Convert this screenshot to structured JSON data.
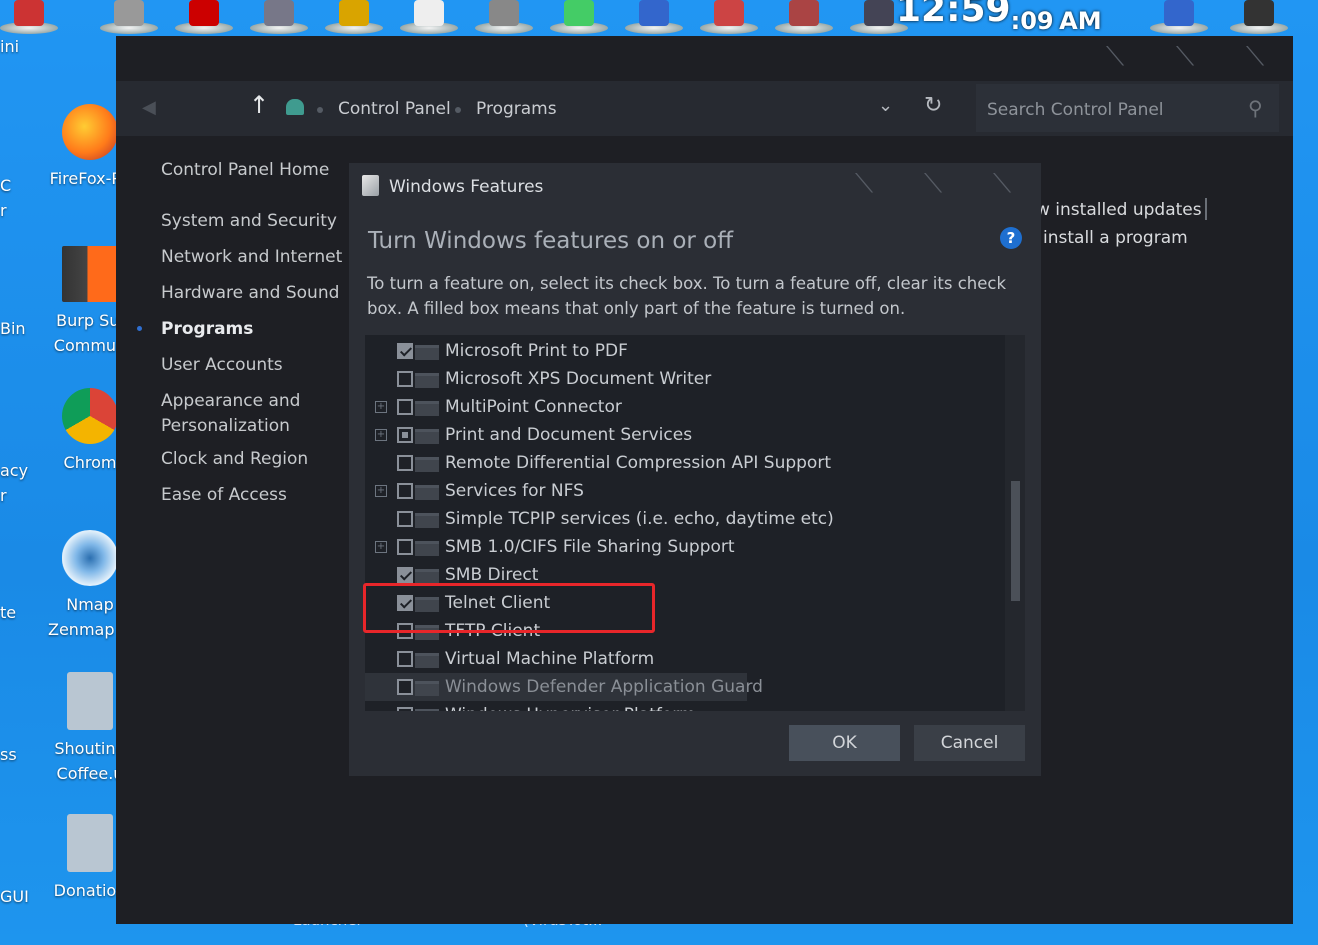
{
  "clock": {
    "time": "12:59",
    "seconds": ":09",
    "ampm": "AM"
  },
  "desktop": {
    "left_labels": [
      "ini",
      "C",
      "r",
      "Bin",
      "acy",
      "r",
      "te",
      "ss",
      "GUI"
    ],
    "icons": [
      {
        "name": "firefox",
        "lines": [
          "FireFox-Pe"
        ]
      },
      {
        "name": "burp",
        "lines": [
          "Burp Sui",
          "Commun"
        ]
      },
      {
        "name": "chrome",
        "lines": [
          "Chrom"
        ]
      },
      {
        "name": "nmap",
        "lines": [
          "Nmap",
          "Zenmap G"
        ]
      },
      {
        "name": "shouting-file",
        "lines": [
          "Shouting",
          "Coffee.u"
        ]
      },
      {
        "name": "donation-file",
        "lines": [
          "Donation"
        ]
      }
    ],
    "bottom_texts": [
      "Launcher",
      "(VirusTot..."
    ]
  },
  "control_panel": {
    "breadcrumb": [
      "Control Panel",
      "Programs"
    ],
    "search_placeholder": "Search Control Panel",
    "sidebar": [
      {
        "label": "Control Panel Home",
        "active": false
      },
      {
        "label": "System and Security",
        "active": false
      },
      {
        "label": "Network and Internet",
        "active": false
      },
      {
        "label": "Hardware and Sound",
        "active": false
      },
      {
        "label": "Programs",
        "active": true
      },
      {
        "label": "User Accounts",
        "active": false
      },
      {
        "label": "Appearance and",
        "active": false
      },
      {
        "label": "Personalization",
        "active": false
      },
      {
        "label": "Clock and Region",
        "active": false
      },
      {
        "label": "Ease of Access",
        "active": false
      }
    ],
    "right_links": [
      "w installed updates",
      "install a program"
    ]
  },
  "dialog": {
    "title": "Windows Features",
    "heading": "Turn Windows features on or off",
    "description": "To turn a feature on, select its check box. To turn a feature off, clear its check box. A filled box means that only part of the feature is turned on.",
    "help": "?",
    "features": [
      {
        "label": "Microsoft Print to PDF",
        "state": "checked",
        "expandable": false
      },
      {
        "label": "Microsoft XPS Document Writer",
        "state": "unchecked",
        "expandable": false
      },
      {
        "label": "MultiPoint Connector",
        "state": "unchecked",
        "expandable": true
      },
      {
        "label": "Print and Document Services",
        "state": "partial",
        "expandable": true
      },
      {
        "label": "Remote Differential Compression API Support",
        "state": "unchecked",
        "expandable": false
      },
      {
        "label": "Services for NFS",
        "state": "unchecked",
        "expandable": true
      },
      {
        "label": "Simple TCPIP services (i.e. echo, daytime etc)",
        "state": "unchecked",
        "expandable": false
      },
      {
        "label": "SMB 1.0/CIFS File Sharing Support",
        "state": "unchecked",
        "expandable": true
      },
      {
        "label": "SMB Direct",
        "state": "checked",
        "expandable": false
      },
      {
        "label": "Telnet Client",
        "state": "checked",
        "expandable": false
      },
      {
        "label": "TFTP Client",
        "state": "unchecked",
        "expandable": false
      },
      {
        "label": "Virtual Machine Platform",
        "state": "unchecked",
        "expandable": false
      },
      {
        "label": "Windows Defender Application Guard",
        "state": "unchecked",
        "expandable": false,
        "disabled": true
      },
      {
        "label": "Windows Hypervisor Platform",
        "state": "unchecked",
        "expandable": false
      }
    ],
    "ok_label": "OK",
    "cancel_label": "Cancel"
  },
  "colors": {
    "highlight": "#e8262a",
    "desktop": "#1d8fe6",
    "panel": "#1e1f24"
  }
}
